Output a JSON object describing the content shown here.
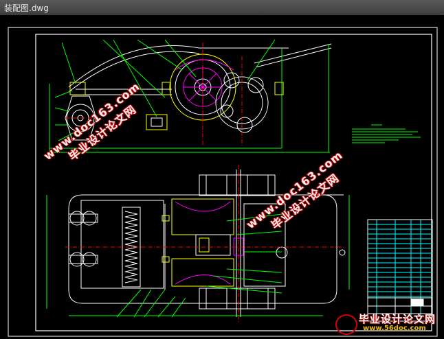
{
  "window": {
    "title": "装配图.dwg"
  },
  "watermarks": {
    "primary_line1": "www.doc163.com",
    "primary_line2": "毕业设计论文网"
  },
  "corner_logo": {
    "title": "毕业设计论文网",
    "url": "www.56doc.com"
  },
  "colors": {
    "background": "#000000",
    "frame": "#ffffff",
    "parts_green": "#00ff00",
    "parts_magenta": "#ff00ff",
    "parts_yellow": "#ffff00",
    "parts_cyan": "#00ffff",
    "watermark_red": "#dd0000"
  }
}
